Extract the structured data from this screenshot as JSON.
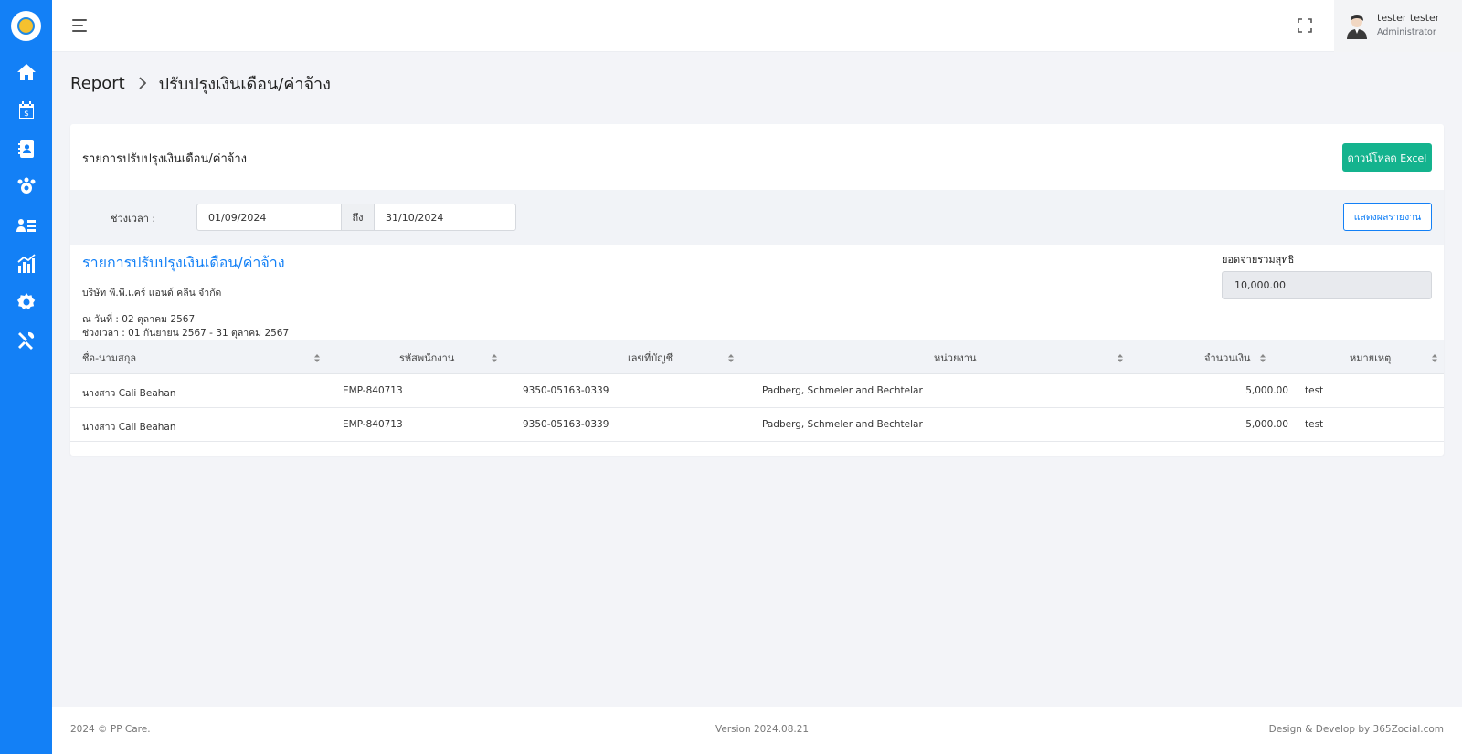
{
  "header": {
    "user_name": "tester tester",
    "user_role": "Administrator"
  },
  "sidebar": {
    "items": [
      {
        "icon": "home-icon"
      },
      {
        "icon": "calendar-money-icon"
      },
      {
        "icon": "contact-book-icon"
      },
      {
        "icon": "team-settings-icon"
      },
      {
        "icon": "user-list-icon"
      },
      {
        "icon": "chart-icon"
      },
      {
        "icon": "gear-icon"
      },
      {
        "icon": "tools-icon"
      }
    ],
    "accent": "#1380f6"
  },
  "breadcrumb": {
    "root": "Report",
    "current": "ปรับปรุงเงินเดือน/ค่าจ้าง"
  },
  "card": {
    "title": "รายการปรับปรุงเงินเดือน/ค่าจ้าง",
    "excel_button": "ดาวน์โหลด Excel",
    "excel_color": "#14b38e"
  },
  "filter": {
    "label": "ช่วงเวลา :",
    "date_from": "01/09/2024",
    "separator": "ถึง",
    "date_to": "31/10/2024",
    "show_button": "แสดงผลรายงาน"
  },
  "report": {
    "title": "รายการปรับปรุงเงินเดือน/ค่าจ้าง",
    "company": "บริษัท พี.พี.แคร์ แอนด์ คลีน จำกัด",
    "as_of": "ณ วันที่ : 02 ตุลาคม 2567",
    "period": "ช่วงเวลา : 01 กันยายน 2567 - 31 ตุลาคม 2567",
    "total_label": "ยอดจ่ายรวมสุทธิ",
    "total_value": "10,000.00"
  },
  "table": {
    "columns": [
      "ชื่อ-นามสกุล",
      "รหัสพนักงาน",
      "เลขที่บัญชี",
      "หน่วยงาน",
      "จำนวนเงิน",
      "หมายเหตุ"
    ],
    "rows": [
      [
        "นางสาว Cali Beahan",
        "EMP-840713",
        "9350-05163-0339",
        "Padberg, Schmeler and Bechtelar",
        "5,000.00",
        "test"
      ],
      [
        "นางสาว Cali Beahan",
        "EMP-840713",
        "9350-05163-0339",
        "Padberg, Schmeler and Bechtelar",
        "5,000.00",
        "test"
      ]
    ]
  },
  "footer": {
    "copyright": "2024 © PP Care.",
    "version": "Version 2024.08.21",
    "credit": "Design & Develop by 365Zocial.com"
  }
}
